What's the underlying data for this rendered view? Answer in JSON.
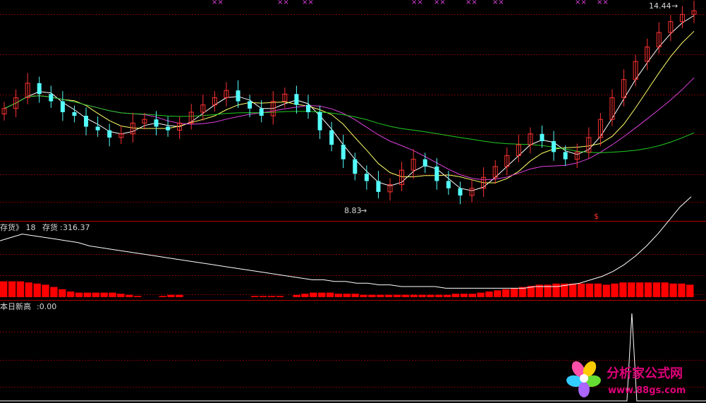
{
  "chart_data": [
    {
      "type": "candlestick",
      "title": "",
      "price_annotations": {
        "high_label": "14.44",
        "low_label": "8.83",
        "arrow": "→"
      },
      "signal_mark": "$",
      "top_markers": "××",
      "ma_lines": [
        {
          "name": "",
          "color": "#ffffff"
        },
        {
          "name": "",
          "color": "#ffff66"
        },
        {
          "name": "",
          "color": "#e040e0"
        },
        {
          "name": "",
          "color": "#22cc22"
        }
      ],
      "candles_seed": [
        11.6,
        11.9,
        12.3,
        12.0,
        11.8,
        11.5,
        11.4,
        11.1,
        11.0,
        10.8,
        10.9,
        11.2,
        11.3,
        11.1,
        11.0,
        11.2,
        11.5,
        11.7,
        11.9,
        12.1,
        11.8,
        11.6,
        11.4,
        11.8,
        12.0,
        11.7,
        11.5,
        11.0,
        10.6,
        10.2,
        9.8,
        9.6,
        9.3,
        9.5,
        9.9,
        10.2,
        10.0,
        9.6,
        9.4,
        9.2,
        9.4,
        9.7,
        10.0,
        10.3,
        10.6,
        10.9,
        10.7,
        10.4,
        10.2,
        10.4,
        10.8,
        11.3,
        11.9,
        12.4,
        12.9,
        13.3,
        13.7,
        14.0,
        14.2,
        14.3
      ]
    },
    {
      "type": "bar+line",
      "legend_prefix": "存货》 18",
      "series_label": "存货",
      "last_value": "316.37",
      "bars": [
        14,
        14,
        14,
        13,
        12,
        11,
        9,
        7,
        5,
        4,
        4,
        4,
        4,
        4,
        3,
        2,
        1,
        0,
        0,
        1,
        2,
        2,
        0,
        0,
        0,
        0,
        0,
        0,
        0,
        0,
        1,
        1,
        1,
        1,
        0,
        2,
        3,
        4,
        4,
        4,
        3,
        3,
        3,
        2,
        2,
        2,
        2,
        2,
        2,
        2,
        2,
        2,
        2,
        2,
        3,
        3,
        3,
        4,
        5,
        6,
        7,
        8,
        9,
        10,
        11,
        11,
        12,
        12,
        12,
        12,
        12,
        12,
        11,
        12,
        13,
        13,
        13,
        13,
        13,
        13,
        12,
        12,
        11
      ],
      "line": [
        32,
        34,
        36,
        35,
        34,
        33,
        32,
        31,
        29,
        28,
        27,
        26,
        25,
        24,
        23,
        22,
        21,
        20,
        19,
        18,
        17,
        16,
        15,
        14,
        13,
        12,
        11,
        10,
        9,
        9,
        8,
        8,
        7,
        7,
        6,
        6,
        5,
        5,
        5,
        5,
        4,
        4,
        4,
        4,
        4,
        4,
        4,
        4,
        5,
        5,
        5,
        6,
        7,
        9,
        11,
        14,
        18,
        23,
        29,
        36,
        44,
        52,
        58
      ]
    },
    {
      "type": "line",
      "legend_prefix": "本日新高",
      "last_value": ":0.00",
      "spike_index": 0.895,
      "values": [
        0,
        0,
        0,
        0,
        0,
        0,
        0,
        1,
        0,
        0,
        0
      ]
    }
  ],
  "watermark": {
    "title": "分析家公式网",
    "url": "www.88gs.com"
  }
}
